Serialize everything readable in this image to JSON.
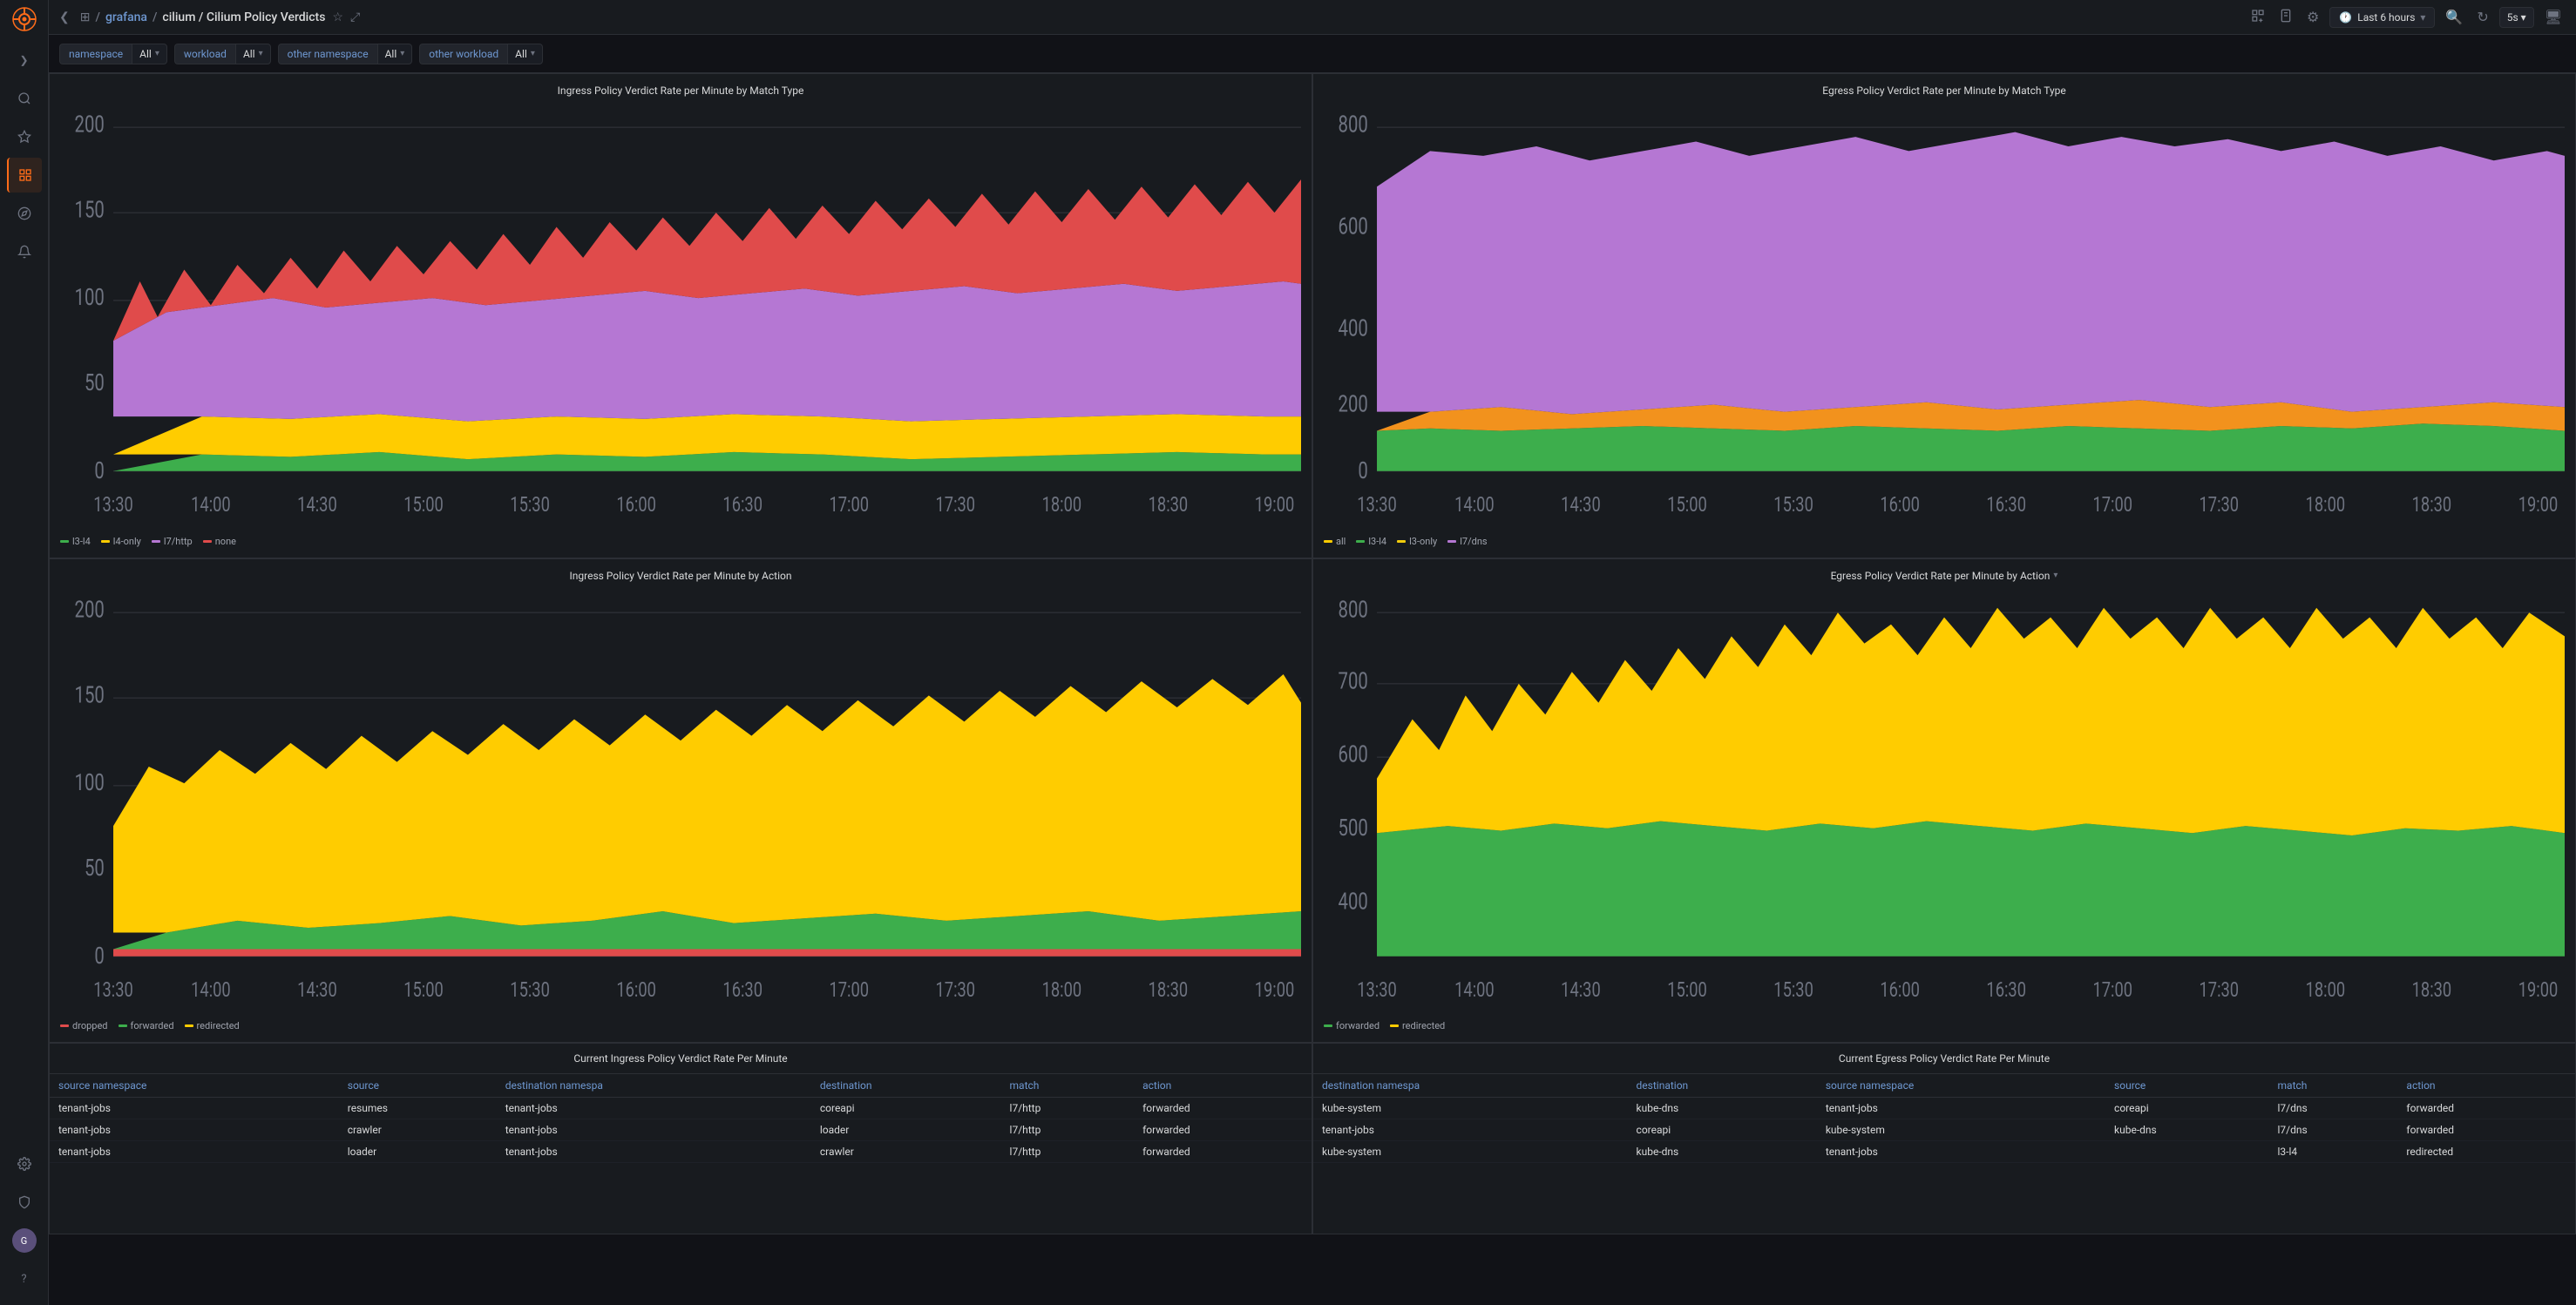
{
  "app": {
    "logo": "grafana",
    "title": "cilium / Cilium Policy Verdicts",
    "star_label": "★",
    "share_label": "⤢"
  },
  "topbar": {
    "time_range": "Last 6 hours",
    "refresh_interval": "5s",
    "zoom_in": "🔍",
    "zoom_out": "🔍"
  },
  "sidebar": {
    "icons": [
      {
        "name": "search",
        "symbol": "🔍",
        "active": false
      },
      {
        "name": "star",
        "symbol": "★",
        "active": false
      },
      {
        "name": "dashboards",
        "symbol": "⊞",
        "active": true
      },
      {
        "name": "explore",
        "symbol": "◎",
        "active": false
      },
      {
        "name": "alerts",
        "symbol": "🔔",
        "active": false
      }
    ],
    "bottom_icons": [
      {
        "name": "settings",
        "symbol": "⚙"
      },
      {
        "name": "shield",
        "symbol": "🛡"
      },
      {
        "name": "help",
        "symbol": "?"
      }
    ],
    "avatar_initials": "G"
  },
  "filters": [
    {
      "label": "namespace",
      "value": "All"
    },
    {
      "label": "workload",
      "value": "All"
    },
    {
      "label": "other namespace",
      "value": "All"
    },
    {
      "label": "other workload",
      "value": "All"
    }
  ],
  "charts": {
    "ingress_match": {
      "title": "Ingress Policy Verdict Rate per Minute by Match Type",
      "y_labels": [
        "200",
        "150",
        "100",
        "50",
        "0"
      ],
      "x_labels": [
        "13:30",
        "14:00",
        "14:30",
        "15:00",
        "15:30",
        "16:00",
        "16:30",
        "17:00",
        "17:30",
        "18:00",
        "18:30",
        "19:00"
      ],
      "legend": [
        {
          "label": "l3-l4",
          "color": "#3dae4c"
        },
        {
          "label": "l4-only",
          "color": "#ffcc00"
        },
        {
          "label": "l7/http",
          "color": "#b577d3"
        },
        {
          "label": "none",
          "color": "#e04b4b"
        }
      ]
    },
    "egress_match": {
      "title": "Egress Policy Verdict Rate per Minute by Match Type",
      "y_labels": [
        "800",
        "600",
        "400",
        "200",
        "0"
      ],
      "x_labels": [
        "13:30",
        "14:00",
        "14:30",
        "15:00",
        "15:30",
        "16:00",
        "16:30",
        "17:00",
        "17:30",
        "18:00",
        "18:30",
        "19:00"
      ],
      "legend": [
        {
          "label": "all",
          "color": "#ffcc00"
        },
        {
          "label": "l3-l4",
          "color": "#3dae4c"
        },
        {
          "label": "l3-only",
          "color": "#f2cc0c"
        },
        {
          "label": "l7/dns",
          "color": "#b577d3"
        }
      ]
    },
    "ingress_action": {
      "title": "Ingress Policy Verdict Rate per Minute by Action",
      "y_labels": [
        "200",
        "150",
        "100",
        "50",
        "0"
      ],
      "x_labels": [
        "13:30",
        "14:00",
        "14:30",
        "15:00",
        "15:30",
        "16:00",
        "16:30",
        "17:00",
        "17:30",
        "18:00",
        "18:30",
        "19:00"
      ],
      "legend": [
        {
          "label": "dropped",
          "color": "#e04b4b"
        },
        {
          "label": "forwarded",
          "color": "#3dae4c"
        },
        {
          "label": "redirected",
          "color": "#ffcc00"
        }
      ]
    },
    "egress_action": {
      "title": "Egress Policy Verdict Rate per Minute by Action",
      "y_labels": [
        "800",
        "700",
        "600",
        "500",
        "400"
      ],
      "x_labels": [
        "13:30",
        "14:00",
        "14:30",
        "15:00",
        "15:30",
        "16:00",
        "16:30",
        "17:00",
        "17:30",
        "18:00",
        "18:30",
        "19:00"
      ],
      "legend": [
        {
          "label": "forwarded",
          "color": "#3dae4c"
        },
        {
          "label": "redirected",
          "color": "#ffcc00"
        }
      ]
    }
  },
  "tables": {
    "ingress": {
      "title": "Current Ingress Policy Verdict Rate Per Minute",
      "columns": [
        "source namespace",
        "source",
        "destination namespa",
        "destination",
        "match",
        "action"
      ],
      "rows": [
        [
          "tenant-jobs",
          "resumes",
          "tenant-jobs",
          "coreapi",
          "l7/http",
          "forwarded"
        ],
        [
          "tenant-jobs",
          "crawler",
          "tenant-jobs",
          "loader",
          "l7/http",
          "forwarded"
        ],
        [
          "tenant-jobs",
          "loader",
          "tenant-jobs",
          "crawler",
          "l7/http",
          "forwarded"
        ]
      ]
    },
    "egress": {
      "title": "Current Egress Policy Verdict Rate Per Minute",
      "columns": [
        "destination namespa",
        "destination",
        "source namespace",
        "source",
        "match",
        "action"
      ],
      "rows": [
        [
          "kube-system",
          "kube-dns",
          "tenant-jobs",
          "coreapi",
          "l7/dns",
          "forwarded"
        ],
        [
          "tenant-jobs",
          "coreapi",
          "kube-system",
          "kube-dns",
          "l7/dns",
          "forwarded"
        ],
        [
          "kube-system",
          "kube-dns",
          "tenant-jobs",
          "",
          "l3-l4",
          "redirected"
        ]
      ]
    }
  }
}
